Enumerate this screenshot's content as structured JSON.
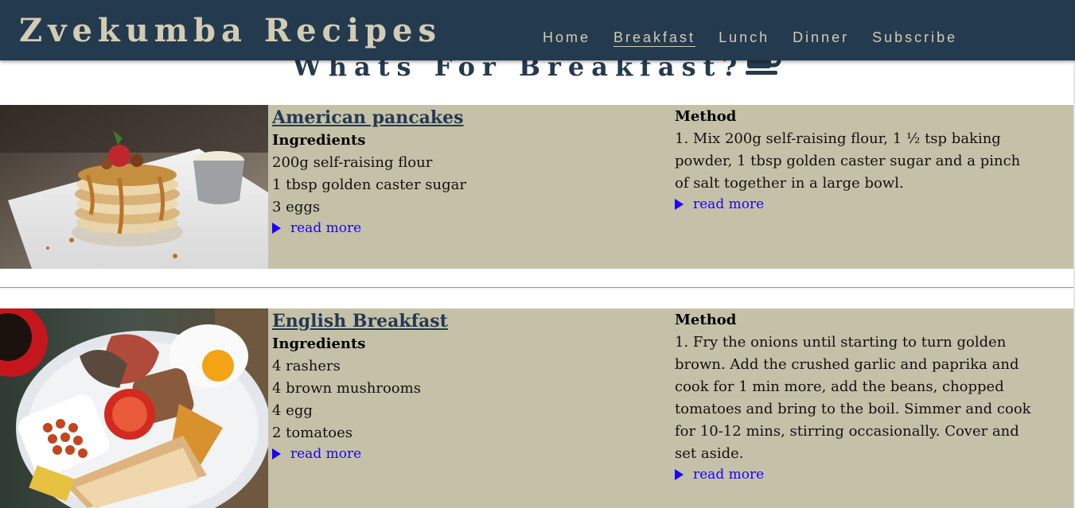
{
  "site": {
    "title": "Zvekumba Recipes"
  },
  "nav": {
    "items": [
      {
        "label": "Home"
      },
      {
        "label": "Breakfast"
      },
      {
        "label": "Lunch"
      },
      {
        "label": "Dinner"
      },
      {
        "label": "Subscribe"
      }
    ],
    "active": "Breakfast"
  },
  "page": {
    "heading": "Whats For Breakfast?",
    "heading_icon": "coffee-cup-icon"
  },
  "recipes": [
    {
      "title": "American pancakes",
      "image": "pancakes-photo",
      "ingredients_heading": "Ingredients",
      "ingredients": [
        "200g self-raising flour",
        "1 tbsp golden caster sugar",
        "3 eggs"
      ],
      "method_heading": "Method",
      "method": "1. Mix 200g self-raising flour, 1 ½ tsp baking powder, 1 tbsp golden caster sugar and a pinch of salt together in a large bowl.",
      "read_more": "read more"
    },
    {
      "title": "English Breakfast",
      "image": "english-breakfast-photo",
      "ingredients_heading": "Ingredients",
      "ingredients": [
        "4 rashers",
        "4 brown mushrooms",
        "4 egg",
        "2 tomatoes"
      ],
      "method_heading": "Method",
      "method": "1. Fry the onions until starting to turn golden brown. Add the crushed garlic and paprika and cook for 1 min more, add the beans, chopped tomatoes and bring to the boil. Simmer and cook for 10-12 mins, stirring occasionally. Cover and set aside.",
      "read_more": "read more"
    }
  ],
  "colors": {
    "header_bg": "#243a4f",
    "header_text": "#d3ccb3",
    "card_bg": "#c5c1a9",
    "link": "#1a00ff"
  }
}
